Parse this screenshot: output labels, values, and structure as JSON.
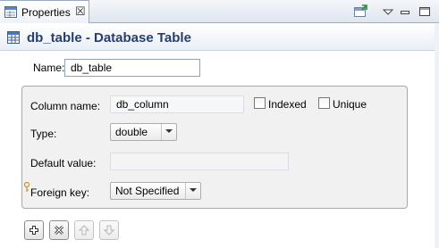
{
  "tab": {
    "title": "Properties",
    "close_glyph": "☒",
    "icon": "properties-icon"
  },
  "view_toolbar": {
    "pin_icon": "pin-to-view-icon",
    "menu_icon": "view-menu-icon",
    "minimize_icon": "minimize-icon",
    "maximize_icon": "maximize-icon"
  },
  "header": {
    "title": "db_table - Database Table",
    "icon": "database-table-icon"
  },
  "form": {
    "name_label": "Name:",
    "name_value": "db_table",
    "column_name_label": "Column name:",
    "column_name_value": "db_column",
    "indexed_label": "Indexed",
    "indexed_checked": false,
    "unique_label": "Unique",
    "unique_checked": false,
    "type_label": "Type:",
    "type_value": "double",
    "default_value_label": "Default value:",
    "default_value": "",
    "foreign_key_label": "Foreign key:",
    "foreign_key_value": "Not Specified"
  },
  "actions": {
    "add_icon": "add-icon",
    "delete_icon": "delete-icon",
    "move_up_icon": "move-up-icon",
    "move_down_icon": "move-down-icon"
  },
  "colors": {
    "header_text": "#253e6a",
    "input_border": "#8aa3c5",
    "group_bg": "#f1f1f1"
  }
}
